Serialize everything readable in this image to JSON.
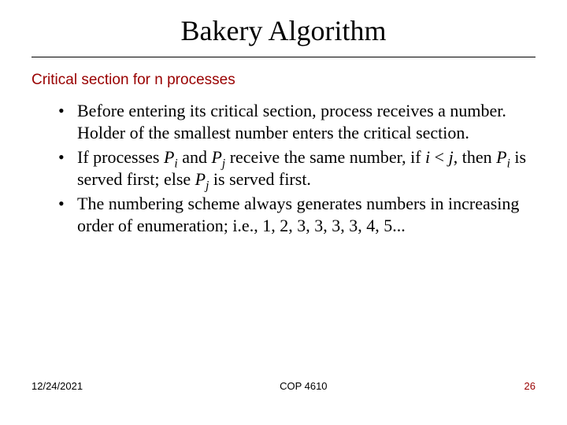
{
  "title": "Bakery Algorithm",
  "subtitle": "Critical section for n processes",
  "bullets": {
    "b1_pre": "Before entering its critical section, process receives a number. Holder of the smallest number enters the critical section.",
    "b2_t1": "If processes ",
    "b2_P": "P",
    "b2_i": "i",
    "b2_and": " and ",
    "b2_j": "j",
    "b2_recv": " receive the same number, if ",
    "b2_ivar": "i",
    "b2_lt": " < ",
    "b2_jvar": "j",
    "b2_then": ", then ",
    "b2_served1": " is served first; else ",
    "b2_served2": " is served first.",
    "b3_t1": "The numbering scheme always generates numbers in increasing order of enumeration; i.e., 1, 2, 3, 3, 3, 3, 4, 5..."
  },
  "footer": {
    "date": "12/24/2021",
    "course": "COP 4610",
    "page": "26"
  }
}
